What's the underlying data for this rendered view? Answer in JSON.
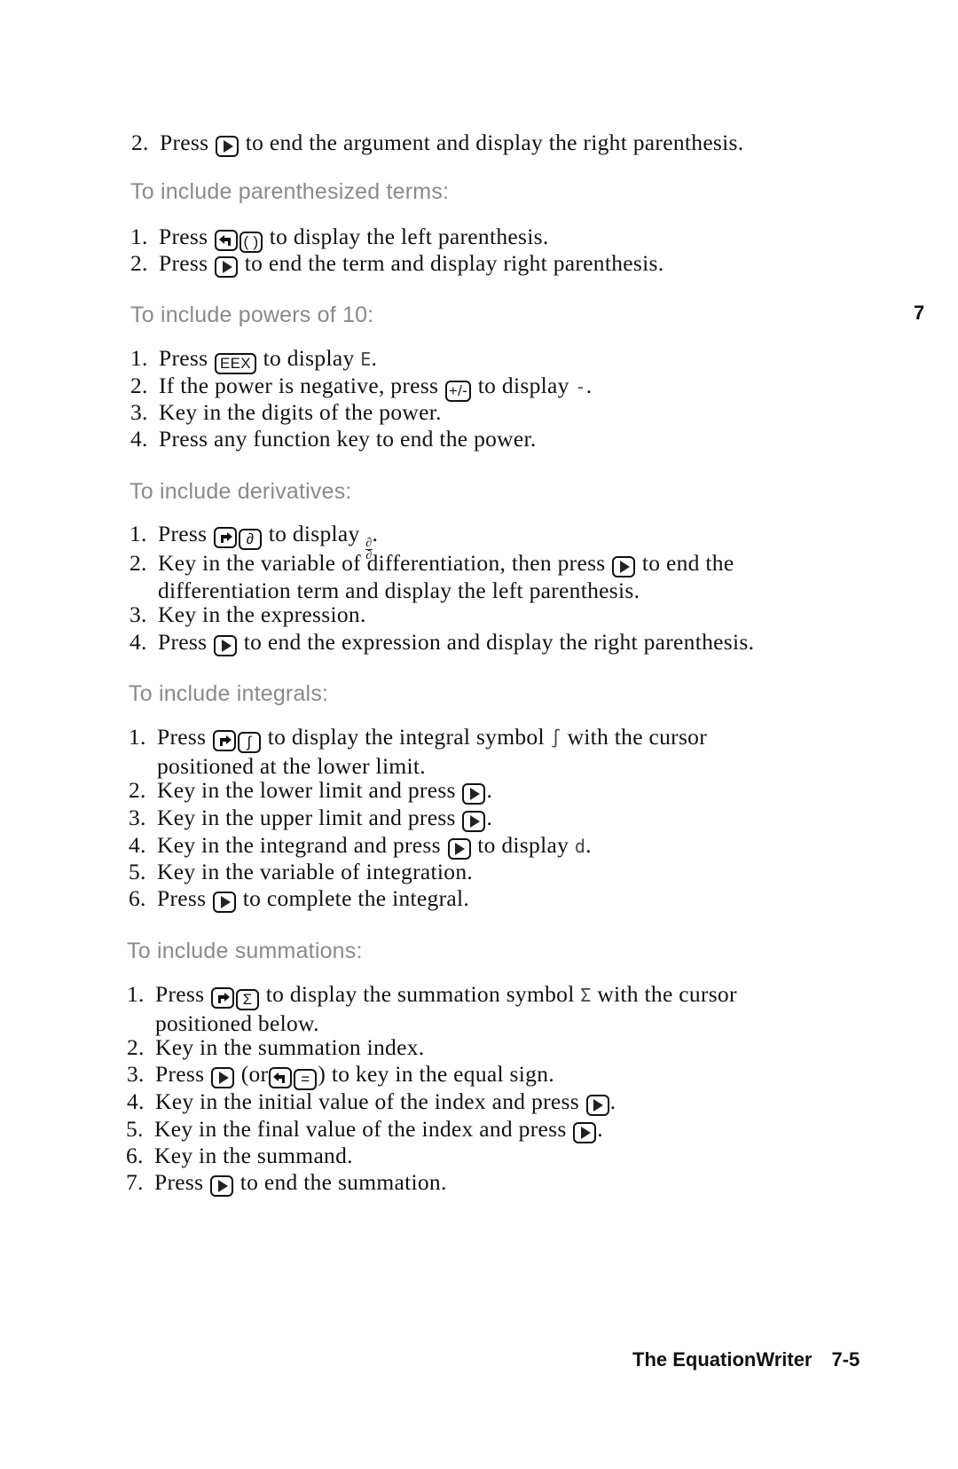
{
  "chapter_tab": "7",
  "footer": {
    "title": "The EquationWriter",
    "page_number": "7-5"
  },
  "intro_step": {
    "number": "2.",
    "before": "Press",
    "key": "right-arrow",
    "after": "to end the argument and display the right parenthesis."
  },
  "sections": [
    {
      "heading": "To include parenthesized terms:",
      "steps": [
        {
          "number": "1.",
          "before": "Press",
          "keys": [
            "left-shift",
            "( )"
          ],
          "after": "to display the left parenthesis."
        },
        {
          "number": "2.",
          "before": "Press",
          "keys": [
            "right-arrow"
          ],
          "after": "to end the term and display right parenthesis."
        }
      ]
    },
    {
      "heading": "To include powers of 10:",
      "steps": [
        {
          "number": "1.",
          "before": "Press",
          "keys": [
            "EEX"
          ],
          "after": "to display",
          "display_char": "E",
          "tail": "."
        },
        {
          "number": "2.",
          "before": "If the power is negative, press",
          "keys": [
            "+/-"
          ],
          "after": "to display",
          "display_char": "-",
          "tail": "."
        },
        {
          "number": "3.",
          "text": "Key in the digits of the power."
        },
        {
          "number": "4.",
          "text": "Press any function key to end the power."
        }
      ]
    },
    {
      "heading": "To include derivatives:",
      "steps": [
        {
          "number": "1.",
          "before": "Press",
          "keys": [
            "right-shift",
            "∂"
          ],
          "after": "to display",
          "display_fraction": [
            "∂",
            "∂"
          ],
          "tail": "."
        },
        {
          "number": "2.",
          "before": "Key in the variable of differentiation, then press",
          "keys": [
            "right-arrow"
          ],
          "after": "to end the",
          "continuation": "differentiation term and display the left parenthesis."
        },
        {
          "number": "3.",
          "text": "Key in the expression."
        },
        {
          "number": "4.",
          "before": "Press",
          "keys": [
            "right-arrow"
          ],
          "after": "to end the expression and display the right parenthesis."
        }
      ]
    },
    {
      "heading": "To include integrals:",
      "steps": [
        {
          "number": "1.",
          "before": "Press",
          "keys": [
            "right-shift",
            "∫"
          ],
          "after": "to display the integral symbol",
          "display_char": "∫",
          "tail": "with the cursor",
          "continuation": "positioned at the lower limit."
        },
        {
          "number": "2.",
          "before": "Key in the lower limit and press",
          "keys": [
            "right-arrow"
          ],
          "after": "."
        },
        {
          "number": "3.",
          "before": "Key in the upper limit and press",
          "keys": [
            "right-arrow"
          ],
          "after": "."
        },
        {
          "number": "4.",
          "before": "Key in the integrand and press",
          "keys": [
            "right-arrow"
          ],
          "after": "to display",
          "display_char": "d",
          "tail": "."
        },
        {
          "number": "5.",
          "text": "Key in the variable of integration."
        },
        {
          "number": "6.",
          "before": "Press",
          "keys": [
            "right-arrow"
          ],
          "after": "to complete the integral."
        }
      ]
    },
    {
      "heading": "To include summations:",
      "steps": [
        {
          "number": "1.",
          "before": "Press",
          "keys": [
            "right-shift",
            "Σ"
          ],
          "after": "to display the summation symbol",
          "display_char": "Σ",
          "tail": "with the cursor",
          "continuation": "positioned below."
        },
        {
          "number": "2.",
          "text": "Key in the summation index."
        },
        {
          "number": "3.",
          "before": "Press",
          "keys": [
            "right-arrow"
          ],
          "after": "(or",
          "keys2": [
            "left-shift",
            "="
          ],
          "after2": ") to key in the equal sign."
        },
        {
          "number": "4.",
          "before": "Key in the initial value of the index and press",
          "keys": [
            "right-arrow"
          ],
          "after": "."
        },
        {
          "number": "5.",
          "before": "Key in the final value of the index and press",
          "keys": [
            "right-arrow"
          ],
          "after": "."
        },
        {
          "number": "6.",
          "text": "Key in the summand."
        },
        {
          "number": "7.",
          "before": "Press",
          "keys": [
            "right-arrow"
          ],
          "after": "to end the summation."
        }
      ]
    }
  ]
}
